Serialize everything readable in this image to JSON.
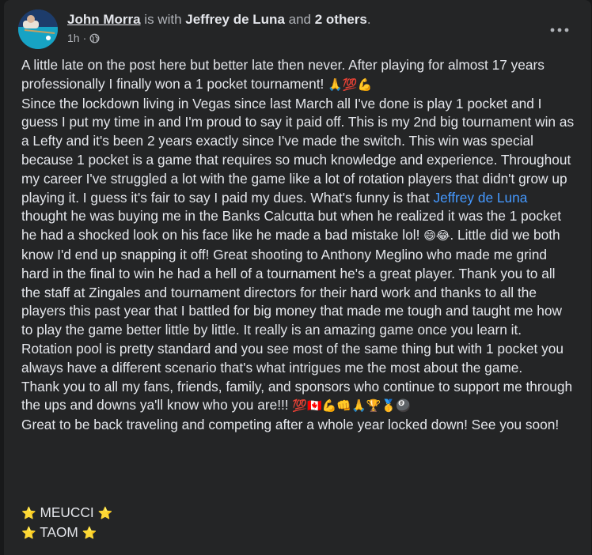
{
  "post": {
    "author": "John Morra",
    "with_text": " is with ",
    "tagged": "Jeffrey de Luna",
    "and_text": " and ",
    "others": "2 others",
    "period": ".",
    "time": "1h",
    "dot": " · ",
    "privacy_icon": "globe-icon",
    "more_icon": "more-options-icon",
    "body_part1": "A little late on the post here but better late then never. After playing for almost 17 years professionally I finally won a 1 pocket tournament! ",
    "body_emojis1": "🙏💯💪",
    "body_part2": "\nSince the lockdown living in Vegas since last March all I've done is play 1 pocket and I guess I put my time in and I'm proud to say it paid off. This is my 2nd big tournament win as a Lefty and it's been 2 years exactly since I've made the switch. This win was special because 1 pocket is a game that requires so much knowledge and experience. Throughout my career I've struggled a lot with the game like a lot of rotation players that didn't grow up playing it. I guess it's fair to say I paid my dues. What's funny is that ",
    "mention": "Jeffrey de Luna",
    "body_part3": " thought he was buying me in the Banks Calcutta but when he realized it was the 1 pocket he had a shocked look on his face like he made a bad mistake lol! ",
    "body_emojis2": "😄😂",
    "body_part4": ". Little did we both know I'd end up snapping it off! Great shooting to Anthony Meglino who made me grind hard in the final to win he had a hell of a tournament he's a great player. Thank you to all the staff at Zingales and tournament directors for their hard work and thanks to all the players this past year that I battled for big money that made me tough and taught me how to play the game better little by little. It really is an amazing game once you learn it. Rotation pool is pretty standard and you see most of the same thing but with 1 pocket you always have a different scenario that's what intrigues me the most about the game.\nThank you to all my fans, friends, family, and sponsors who continue to support me through the ups and downs ya'll know who you are!!! ",
    "body_emojis3": "💯🇨🇦💪👊🙏🏆🥇🎱",
    "body_part5": "\nGreat to be back traveling and competing after a whole year locked down! See you soon!",
    "star": "⭐",
    "sponsor1": "MEUCCI",
    "sponsor2": "TAOM"
  }
}
